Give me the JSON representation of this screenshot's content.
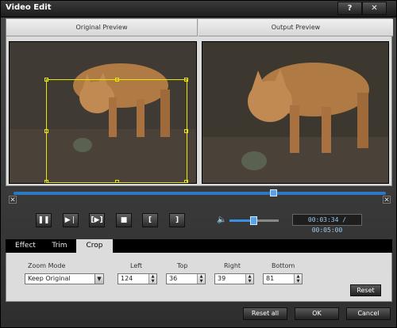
{
  "window": {
    "title": "Video Edit",
    "help": "?",
    "close": "✕"
  },
  "preview": {
    "original_label": "Original Preview",
    "output_label": "Output Preview"
  },
  "playback": {
    "progress": 0.7,
    "pause": "❚❚",
    "step": "▶❘",
    "range": "[▶]",
    "stop": "■",
    "mark_in": "[",
    "mark_out": "]",
    "volume_icon": "🔈",
    "volume": 0.5,
    "timecode": "00:03:34 / 00:05:00",
    "marker_left": "✕",
    "marker_right": "✕"
  },
  "tabs": [
    {
      "label": "Effect",
      "active": false
    },
    {
      "label": "Trim",
      "active": false
    },
    {
      "label": "Crop",
      "active": true
    }
  ],
  "crop": {
    "zoom_mode_label": "Zoom Mode",
    "zoom_mode_value": "Keep Original",
    "left_label": "Left",
    "left_value": "124",
    "top_label": "Top",
    "top_value": "36",
    "right_label": "Right",
    "right_value": "39",
    "bottom_label": "Bottom",
    "bottom_value": "81",
    "reset": "Reset"
  },
  "footer": {
    "reset_all": "Reset all",
    "ok": "OK",
    "cancel": "Cancel"
  },
  "icons": [
    "help-icon",
    "close-icon",
    "pause-icon",
    "step-forward-icon",
    "play-range-icon",
    "stop-icon",
    "mark-in-icon",
    "mark-out-icon",
    "volume-icon",
    "dropdown-arrow-icon",
    "spin-arrows-icon"
  ]
}
